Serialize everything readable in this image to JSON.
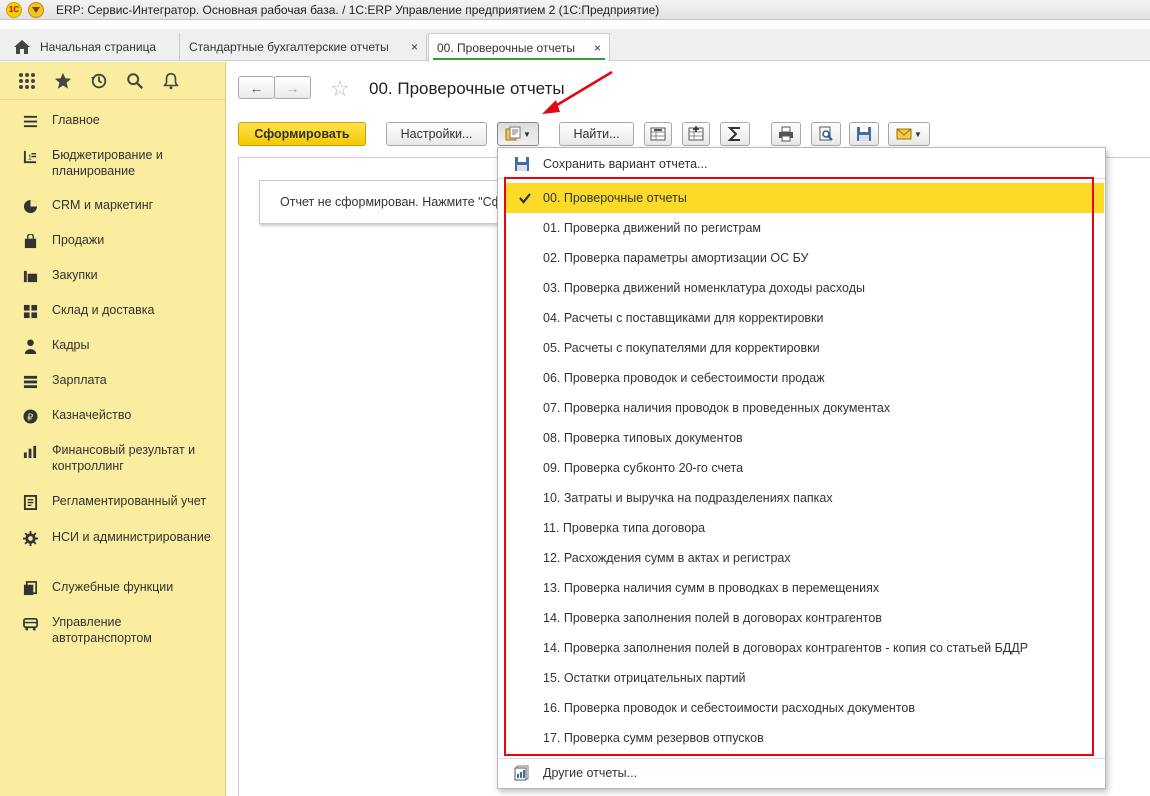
{
  "window": {
    "logo_text": "1C",
    "title": "ERP: Сервис-Интегратор. Основная рабочая база. / 1С:ERP Управление предприятием 2  (1С:Предприятие)"
  },
  "tabs": [
    {
      "label": "Начальная страница"
    },
    {
      "label": "Стандартные бухгалтерские отчеты",
      "close": "×"
    },
    {
      "label": "00. Проверочные отчеты",
      "close": "×"
    }
  ],
  "sidebar": {
    "items": [
      {
        "label": "Главное",
        "icon": "menu-lines-icon"
      },
      {
        "label": "Бюджетирование и планирование",
        "icon": "budget-icon"
      },
      {
        "label": "CRM и маркетинг",
        "icon": "pie-chart-icon"
      },
      {
        "label": "Продажи",
        "icon": "shopping-bag-icon"
      },
      {
        "label": "Закупки",
        "icon": "cart-icon"
      },
      {
        "label": "Склад и доставка",
        "icon": "warehouse-icon"
      },
      {
        "label": "Кадры",
        "icon": "person-icon"
      },
      {
        "label": "Зарплата",
        "icon": "payroll-icon"
      },
      {
        "label": "Казначейство",
        "icon": "ruble-icon"
      },
      {
        "label": "Финансовый результат и контроллинг",
        "icon": "bar-chart-icon"
      },
      {
        "label": "Регламентированный учет",
        "icon": "ledger-icon"
      },
      {
        "label": "НСИ и администрирование",
        "icon": "gear-icon"
      },
      {
        "label": "Служебные функции",
        "icon": "documents-icon"
      },
      {
        "label": "Управление автотранспортом",
        "icon": "truck-icon"
      }
    ]
  },
  "form": {
    "back": "←",
    "forward": "→",
    "star": "☆",
    "title": "00. Проверочные отчеты",
    "generate_button": "Сформировать",
    "settings_button": "Настройки...",
    "find_button": "Найти...",
    "notice": "Отчет не сформирован. Нажмите \"Сформировать\" для получения отчета."
  },
  "dropdown": {
    "save_variant": "Сохранить вариант отчета...",
    "variants": [
      "00. Проверочные отчеты",
      "01. Проверка движений по регистрам",
      "02. Проверка параметры амортизации ОС БУ",
      "03. Проверка движений номенклатура доходы расходы",
      "04. Расчеты с поставщиками для корректировки",
      "05. Расчеты с покупателями для корректировки",
      "06. Проверка проводок и себестоимости продаж",
      "07. Проверка наличия проводок в проведенных документах",
      "08. Проверка типовых документов",
      "09. Проверка субконто 20-го счета",
      "10. Затраты и выручка на подразделениях папках",
      "11. Проверка типа договора",
      "12. Расхождения сумм в актах и регистрах",
      "13. Проверка наличия сумм в проводках в перемещениях",
      "14. Проверка заполнения полей в договорах контрагентов",
      "14. Проверка заполнения полей в договорах контрагентов - копия со статьей БДДР",
      "15. Остатки отрицательных партий",
      "16. Проверка проводок и себестоимости расходных документов",
      "17. Проверка сумм резервов отпусков"
    ],
    "selected_index": 0,
    "other_reports": "Другие отчеты..."
  },
  "colors": {
    "sidebar_bg": "#fbeda0",
    "primary_button": "#f4c800",
    "selected_row": "#fbdb28",
    "annotation_red": "#e30613"
  }
}
